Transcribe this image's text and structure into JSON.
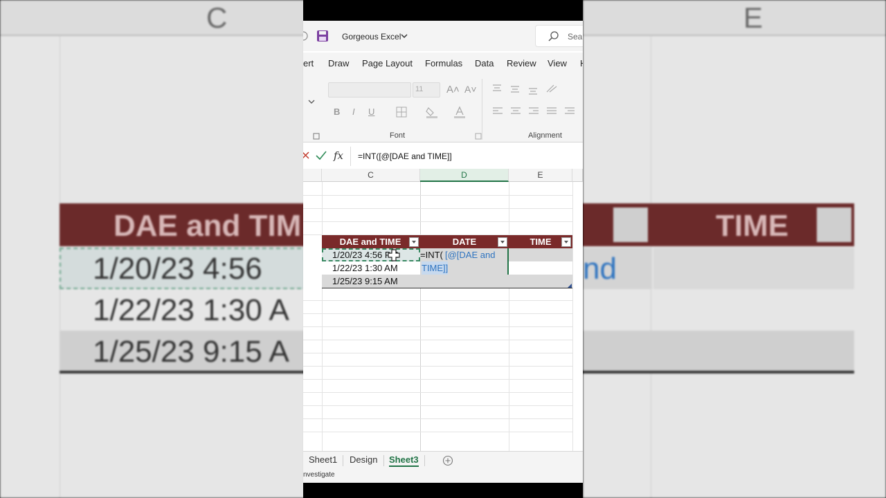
{
  "background": {
    "left_col": "C",
    "right_col": "E",
    "left_header": "DAE and TIM",
    "right_header": "TIME",
    "left_rows": [
      "1/20/23 4:56",
      "1/22/23 1:30 A",
      "1/25/23 9:15 A"
    ],
    "right_partial": "nd"
  },
  "title_bar": {
    "workbook_name": "Gorgeous Excel",
    "search_placeholder": "Sea"
  },
  "tabs": [
    "ert",
    "Draw",
    "Page Layout",
    "Formulas",
    "Data",
    "Review",
    "View",
    "H"
  ],
  "ribbon": {
    "font_size": "11",
    "font_group_label": "Font",
    "alignment_group_label": "Alignment",
    "bold": "B",
    "italic": "I",
    "underline": "U",
    "grow_font": "A˄",
    "shrink_font": "A˅"
  },
  "formula_bar": {
    "fx": "fx",
    "formula": "=INT([@[DAE and TIME]]"
  },
  "grid": {
    "columns": [
      "C",
      "D",
      "E"
    ],
    "active_column": "D",
    "table_headers": [
      "DAE and TIME",
      "DATE",
      "TIME"
    ],
    "rows": [
      {
        "datetime": "1/20/23 4:56 PM"
      },
      {
        "datetime": "1/22/23 1:30 AM"
      },
      {
        "datetime": "1/25/23 9:15 AM"
      }
    ],
    "editing_prefix": "=INT(",
    "editing_ref_line1": "[@[DAE and",
    "editing_ref_line2": "TIME]]"
  },
  "sheets": [
    "Sheet1",
    "Design",
    "Sheet3"
  ],
  "active_sheet": "Sheet3",
  "status": "nvestigate",
  "colors": {
    "table_header": "#7a2a2a",
    "accent": "#217346",
    "ref": "#2f74c0"
  }
}
